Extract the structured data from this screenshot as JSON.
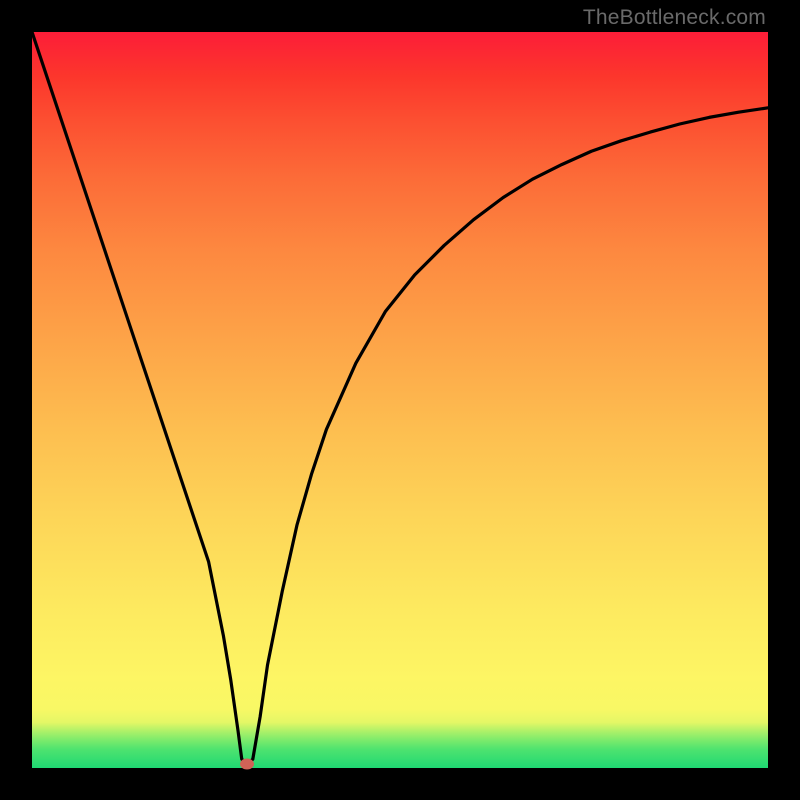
{
  "watermark": "TheBottleneck.com",
  "colors": {
    "frame": "#000000",
    "curve": "#000000",
    "marker": "#d06357"
  },
  "chart_data": {
    "type": "line",
    "title": "",
    "xlabel": "",
    "ylabel": "",
    "xlim": [
      0,
      100
    ],
    "ylim": [
      0,
      100
    ],
    "grid": false,
    "legend": false,
    "series": [
      {
        "name": "curve",
        "x": [
          0,
          5,
          10,
          15,
          20,
          22,
          24,
          26,
          27,
          28,
          28.5,
          29,
          29.5,
          30,
          31,
          32,
          34,
          36,
          38,
          40,
          44,
          48,
          52,
          56,
          60,
          64,
          68,
          72,
          76,
          80,
          84,
          88,
          92,
          96,
          100
        ],
        "y": [
          100,
          85,
          70,
          55,
          40,
          34,
          28,
          18,
          12,
          5,
          1.2,
          0.7,
          0.7,
          1.2,
          7,
          14,
          24,
          33,
          40,
          46,
          55,
          62,
          67,
          71,
          74.5,
          77.5,
          80,
          82,
          83.8,
          85.2,
          86.4,
          87.5,
          88.4,
          89.1,
          89.7
        ]
      }
    ],
    "annotations": [
      {
        "name": "minimum-marker",
        "x": 29.2,
        "y": 0.6
      }
    ]
  }
}
